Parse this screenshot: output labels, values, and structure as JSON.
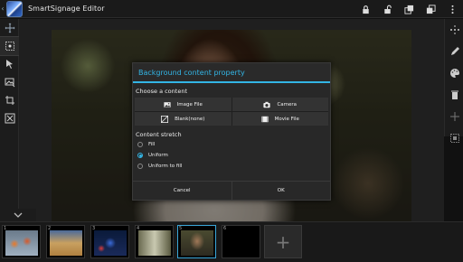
{
  "app": {
    "title": "SmartSignage Editor"
  },
  "actionbar": {
    "icons": [
      "lock-icon",
      "unlock-icon",
      "bring-front-icon",
      "send-back-icon",
      "overflow-menu-icon"
    ]
  },
  "left_toolbar": {
    "icons": [
      "move-icon",
      "select-target-icon",
      "select-arrow-icon",
      "image-tool-icon",
      "crop-tool-icon",
      "fit-screen-icon"
    ]
  },
  "right_toolbar": {
    "icons": [
      "more-dots-icon",
      "edit-pencil-icon",
      "palette-icon",
      "delete-icon",
      "move-cross-icon",
      "grid-select-icon"
    ]
  },
  "dialog": {
    "title": "Background content property",
    "choose_label": "Choose a content",
    "buttons": {
      "image_file": "Image File",
      "camera": "Camera",
      "blank": "Blank(none)",
      "movie_file": "Movie File"
    },
    "stretch_label": "Content stretch",
    "options": [
      {
        "label": "Fill",
        "selected": false
      },
      {
        "label": "Uniform",
        "selected": true
      },
      {
        "label": "Uniform to fill",
        "selected": false
      }
    ],
    "cancel": "Cancel",
    "ok": "OK"
  },
  "thumbnails": [
    {
      "num": "1"
    },
    {
      "num": "2"
    },
    {
      "num": "3"
    },
    {
      "num": "4"
    },
    {
      "num": "5"
    },
    {
      "num": "6"
    }
  ],
  "colors": {
    "accent": "#33b5e5"
  }
}
